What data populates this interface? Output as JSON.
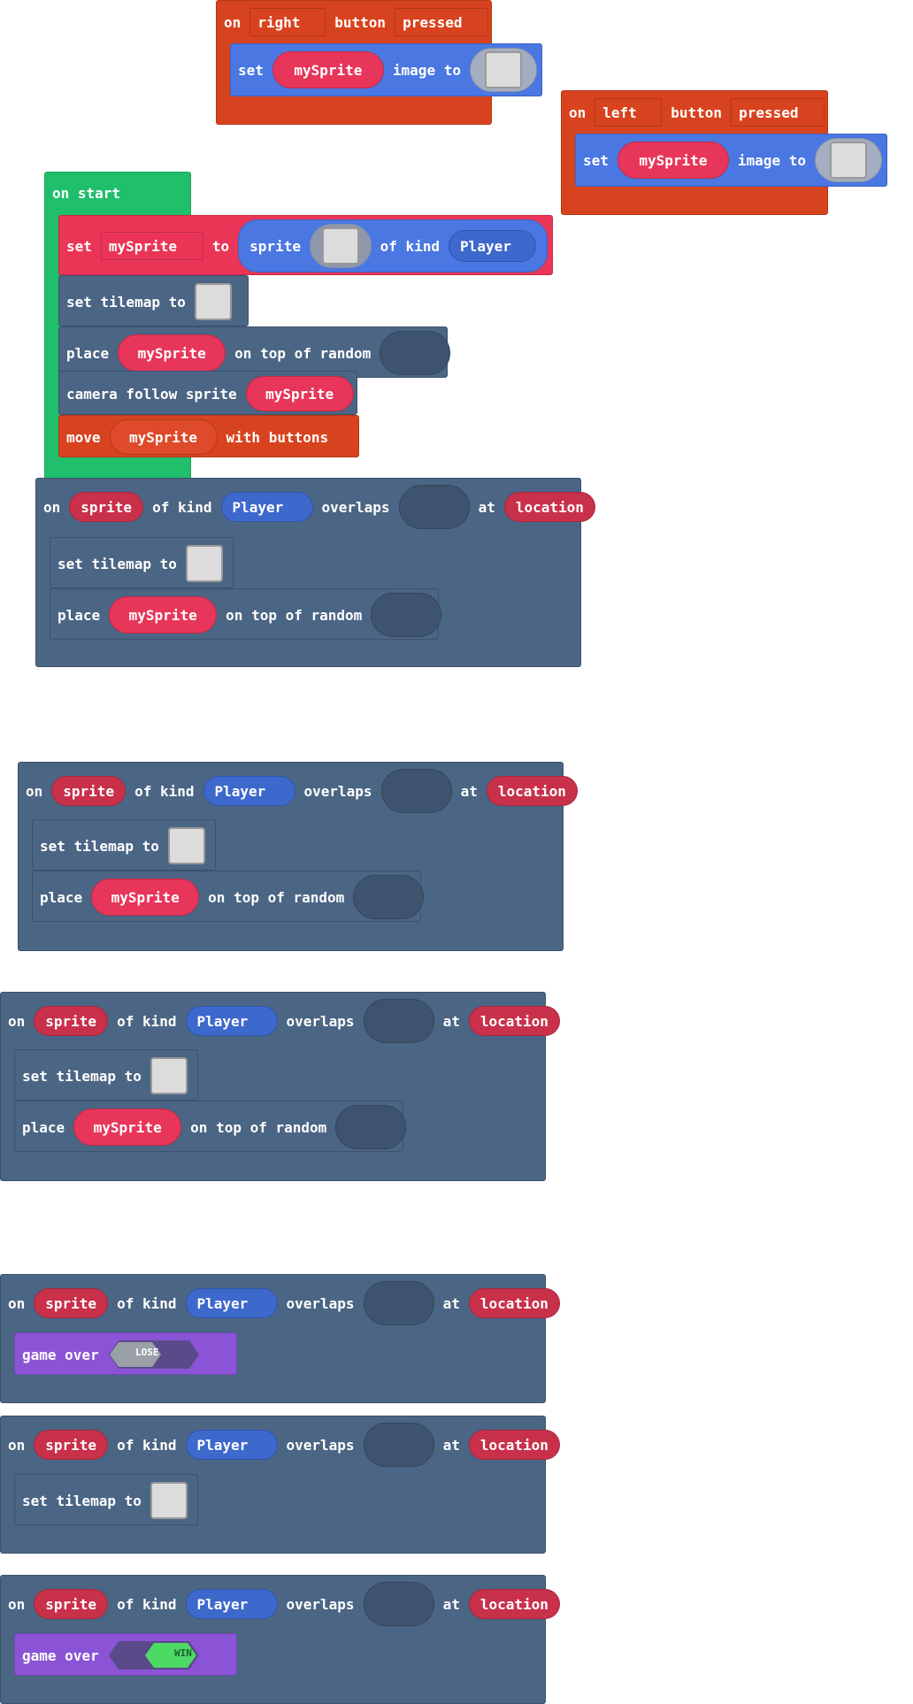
{
  "blocks": {
    "right_button": {
      "on": "on",
      "button_name": "right",
      "button": "button",
      "state": "pressed",
      "set": "set",
      "var": "mySprite",
      "image_to": "image to"
    },
    "left_button": {
      "on": "on",
      "button_name": "left",
      "button": "button",
      "state": "pressed",
      "set": "set",
      "var": "mySprite",
      "image_to": "image to"
    },
    "on_start": {
      "label": "on start",
      "set": "set",
      "var_dd": "mySprite",
      "to": "to",
      "sprite": "sprite",
      "of_kind": "of kind",
      "kind": "Player",
      "set_tilemap": "set tilemap to",
      "place": "place",
      "place_var": "mySprite",
      "on_top_of_random": "on top of random",
      "camera_follow": "camera follow sprite",
      "camera_var": "mySprite",
      "move": "move",
      "move_var": "mySprite",
      "with_buttons": "with buttons"
    },
    "overlap": {
      "on": "on",
      "sprite": "sprite",
      "of_kind": "of kind",
      "kind": "Player",
      "overlaps": "overlaps",
      "at": "at",
      "location": "location",
      "set_tilemap": "set tilemap to",
      "place": "place",
      "place_var": "mySprite",
      "on_top_of_random": "on top of random",
      "game_over": "game over",
      "lose": "LOSE",
      "win": "WIN"
    }
  },
  "colors": {
    "events_red": "#d8431f",
    "sprites_blue": "#4a77e2",
    "loops_green": "#20bf6b",
    "variables_pink": "#ea3557",
    "scene_slate": "#4b6584",
    "game_purple": "#8b54d6"
  }
}
